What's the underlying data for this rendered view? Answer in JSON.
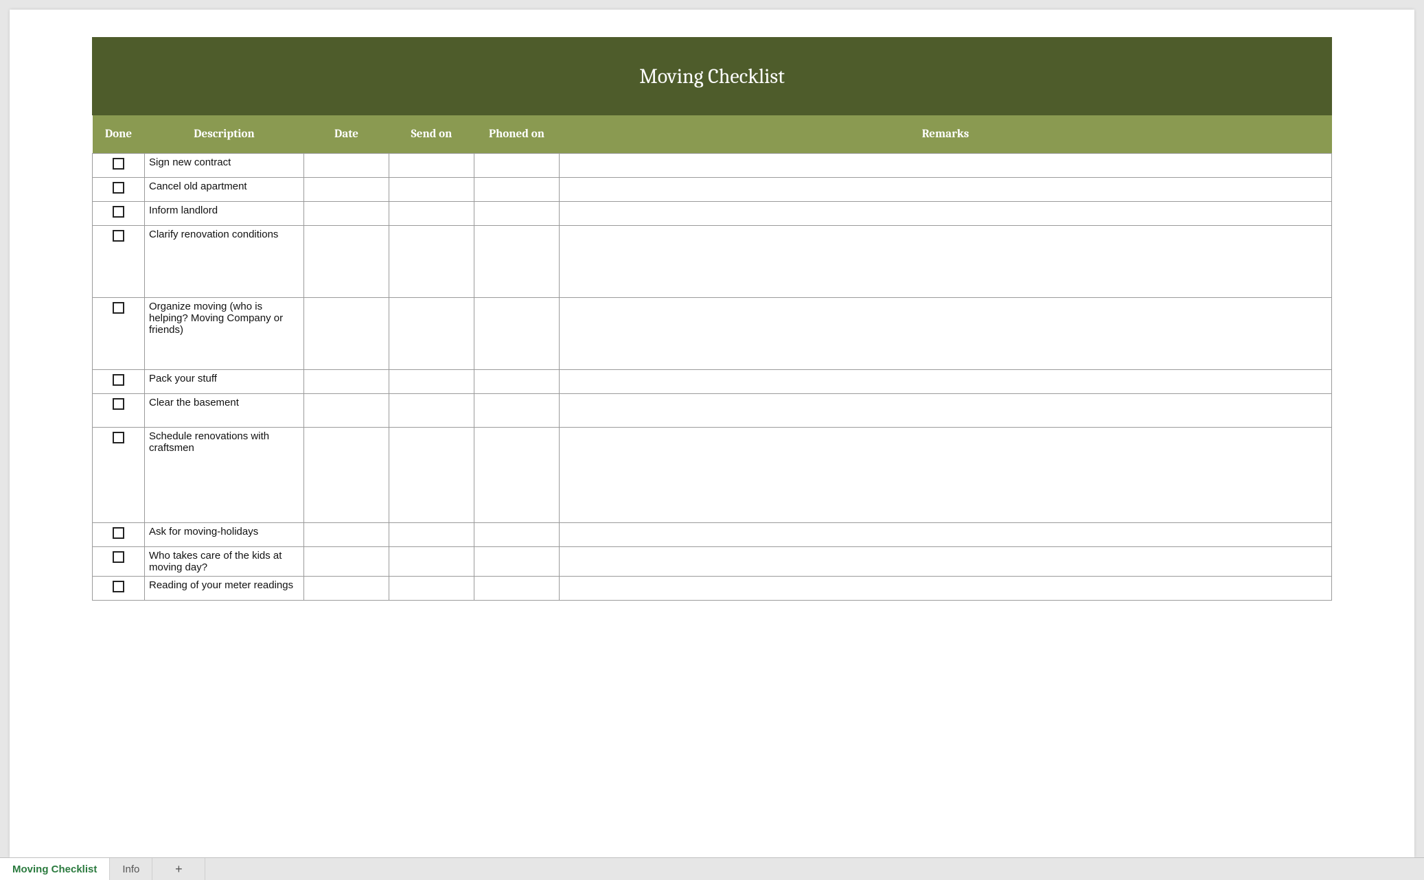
{
  "title": "Moving Checklist",
  "headers": {
    "done": "Done",
    "description": "Description",
    "date": "Date",
    "send_on": "Send on",
    "phoned_on": "Phoned on",
    "remarks": "Remarks"
  },
  "rows": [
    {
      "done": false,
      "description": "Sign new contract",
      "date": "",
      "send_on": "",
      "phoned_on": "",
      "remarks": "",
      "size": "sm"
    },
    {
      "done": false,
      "description": "Cancel old apartment",
      "date": "",
      "send_on": "",
      "phoned_on": "",
      "remarks": "",
      "size": "sm"
    },
    {
      "done": false,
      "description": "Inform landlord",
      "date": "",
      "send_on": "",
      "phoned_on": "",
      "remarks": "",
      "size": "sm"
    },
    {
      "done": false,
      "description": "Clarify renovation conditions",
      "date": "",
      "send_on": "",
      "phoned_on": "",
      "remarks": "",
      "size": "lg"
    },
    {
      "done": false,
      "description": "Organize moving (who is helping? Moving Company or friends)",
      "date": "",
      "send_on": "",
      "phoned_on": "",
      "remarks": "",
      "size": "lg"
    },
    {
      "done": false,
      "description": "Pack your stuff",
      "date": "",
      "send_on": "",
      "phoned_on": "",
      "remarks": "",
      "size": "sm"
    },
    {
      "done": false,
      "description": "Clear the basement",
      "date": "",
      "send_on": "",
      "phoned_on": "",
      "remarks": "",
      "size": "md"
    },
    {
      "done": false,
      "description": "Schedule renovations with craftsmen",
      "date": "",
      "send_on": "",
      "phoned_on": "",
      "remarks": "",
      "size": "xl"
    },
    {
      "done": false,
      "description": "Ask for moving-holidays",
      "date": "",
      "send_on": "",
      "phoned_on": "",
      "remarks": "",
      "size": "sm"
    },
    {
      "done": false,
      "description": "Who takes care of the kids at moving day?",
      "date": "",
      "send_on": "",
      "phoned_on": "",
      "remarks": "",
      "size": "sm"
    },
    {
      "done": false,
      "description": "Reading of your meter readings",
      "date": "",
      "send_on": "",
      "phoned_on": "",
      "remarks": "",
      "size": "sm"
    }
  ],
  "tabs": {
    "active": "Moving Checklist",
    "other": "Info",
    "plus": "+"
  }
}
